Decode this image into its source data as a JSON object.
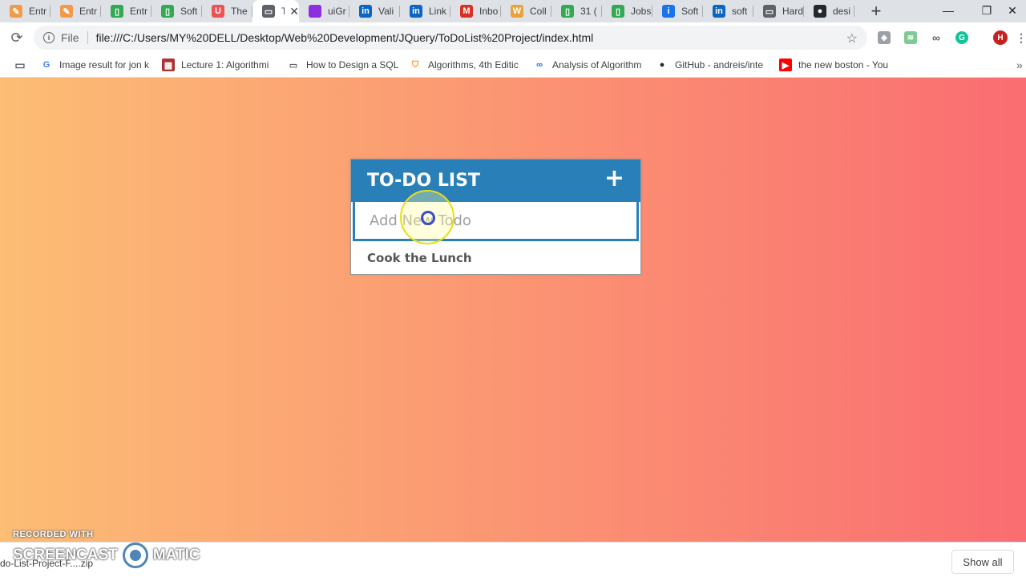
{
  "browser": {
    "tabs": [
      {
        "label": "Entr",
        "icon": "blogger-icon",
        "color": "#f2994a",
        "glyph": "✎"
      },
      {
        "label": "Entr",
        "icon": "blogger-icon",
        "color": "#f2994a",
        "glyph": "✎"
      },
      {
        "label": "Entr",
        "icon": "sheet-icon",
        "color": "#34a853",
        "glyph": "▯"
      },
      {
        "label": "Soft",
        "icon": "sheet-icon",
        "color": "#34a853",
        "glyph": "▯"
      },
      {
        "label": "The",
        "icon": "udemy-icon",
        "color": "#ec5252",
        "glyph": "U"
      },
      {
        "label": "T",
        "icon": "document-icon",
        "color": "#5f6368",
        "glyph": "▭",
        "active": true
      },
      {
        "label": "uiGr",
        "icon": "uigradients-icon",
        "color": "#8e2de2",
        "glyph": ""
      },
      {
        "label": "Vali",
        "icon": "linkedin-icon",
        "color": "#0a66c2",
        "glyph": "in"
      },
      {
        "label": "Link",
        "icon": "linkedin-icon",
        "color": "#0a66c2",
        "glyph": "in"
      },
      {
        "label": "Inbo",
        "icon": "gmail-icon",
        "color": "#d93025",
        "glyph": "M"
      },
      {
        "label": "Coll",
        "icon": "wordpress-icon",
        "color": "#e8a33d",
        "glyph": "W"
      },
      {
        "label": "31 (",
        "icon": "sheet-icon",
        "color": "#34a853",
        "glyph": "▯"
      },
      {
        "label": "Jobs",
        "icon": "sheet-icon",
        "color": "#34a853",
        "glyph": "▯"
      },
      {
        "label": "Soft",
        "icon": "info-icon",
        "color": "#1a73e8",
        "glyph": "i"
      },
      {
        "label": "soft",
        "icon": "linkedin-icon",
        "color": "#0a66c2",
        "glyph": "in"
      },
      {
        "label": "Hard",
        "icon": "document-icon",
        "color": "#5f6368",
        "glyph": "▭"
      },
      {
        "label": "desi",
        "icon": "github-icon",
        "color": "#24292e",
        "glyph": "●"
      }
    ],
    "new_tab_label": "+",
    "window_controls": {
      "minimize": "—",
      "maximize": "❐",
      "close": "✕"
    },
    "address": {
      "scheme_label": "File",
      "url": "file:///C:/Users/MY%20DELL/Desktop/Web%20Development/JQuery/ToDoList%20Project/index.html"
    },
    "profile_initial": "H",
    "bookmarks": [
      {
        "label": "Image result for jon k",
        "icon": "google-icon"
      },
      {
        "label": "Lecture 1: Algorithmi",
        "icon": "lecture-icon"
      },
      {
        "label": "How to Design a SQL",
        "icon": "document-icon"
      },
      {
        "label": "Algorithms, 4th Editic",
        "icon": "princeton-icon"
      },
      {
        "label": "Analysis of Algorithm",
        "icon": "link-icon"
      },
      {
        "label": "GitHub - andreis/inte",
        "icon": "github-icon"
      },
      {
        "label": "the new boston - You",
        "icon": "youtube-icon"
      }
    ]
  },
  "app": {
    "title": "TO-DO LIST",
    "add_icon": "+",
    "input_placeholder": "Add New Todo",
    "todos": [
      "Cook the Lunch"
    ],
    "colors": {
      "header": "#2980b9",
      "gradient_start": "#fcbd74",
      "gradient_end": "#fa6d72"
    }
  },
  "watermark": {
    "recorded_with": "RECORDED WITH",
    "brand_left": "SCREENCAST",
    "brand_right": "MATIC"
  },
  "downloads": {
    "file_label": "do-List-Project-F....zip",
    "show_all_label": "Show all"
  }
}
